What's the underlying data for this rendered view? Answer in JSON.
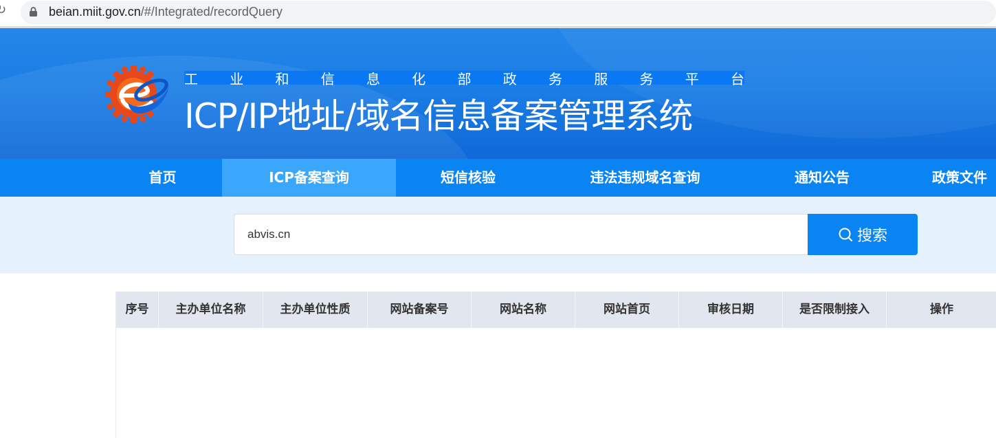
{
  "browser": {
    "url_host": "beian.miit.gov.cn",
    "url_path": "/#/Integrated/recordQuery"
  },
  "header": {
    "subtitle_chars": [
      "工",
      "业",
      "和",
      "信",
      "息",
      "化",
      "部",
      "政",
      "务",
      "服",
      "务",
      "平",
      "台"
    ],
    "title": "ICP/IP地址/域名信息备案管理系统"
  },
  "nav": {
    "items": [
      {
        "label": "首页"
      },
      {
        "label": "ICP备案查询"
      },
      {
        "label": "短信核验"
      },
      {
        "label": "违法违规域名查询"
      },
      {
        "label": "通知公告"
      },
      {
        "label": "政策文件"
      }
    ],
    "active_index": 1
  },
  "search": {
    "value": "abvis.cn",
    "button_label": "搜索"
  },
  "table": {
    "headers": [
      "序号",
      "主办单位名称",
      "主办单位性质",
      "网站备案号",
      "网站名称",
      "网站首页",
      "审核日期",
      "是否限制接入",
      "操作"
    ],
    "rows": []
  },
  "colors": {
    "nav_bg": "#0a83f3",
    "nav_active": "#3aa7fd",
    "banner": "#1b7ee5",
    "search_zone": "#e5f1fd",
    "table_header": "#e2e6ee"
  }
}
